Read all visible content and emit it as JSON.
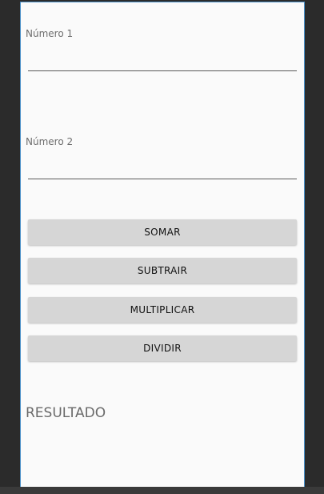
{
  "fields": {
    "numero1": {
      "label": "Número 1",
      "value": "",
      "placeholder": ""
    },
    "numero2": {
      "label": "Número 2",
      "value": "",
      "placeholder": ""
    }
  },
  "buttons": {
    "somar": "SOMAR",
    "subtrair": "SUBTRAIR",
    "multiplicar": "MULTIPLICAR",
    "dividir": "DIVIDIR"
  },
  "result": {
    "text": "RESULTADO"
  },
  "colors": {
    "screen_background": "#fafafa",
    "button_background": "#d6d6d6",
    "frame_border": "#4a90c8"
  }
}
